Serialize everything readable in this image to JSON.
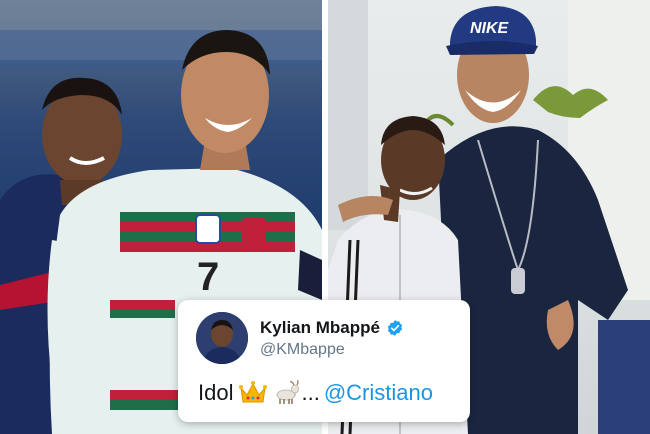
{
  "tweet": {
    "author_name": "Kylian Mbappé",
    "handle": "@KMbappe",
    "text": "Idol",
    "emoji_1": "crown-emoji",
    "emoji_2": "goat-emoji",
    "ellipsis": "...",
    "mention": "@Cristiano"
  },
  "left_photo": {
    "shirt_number": "7"
  },
  "right_photo": {
    "cap_logo": "NIKE"
  },
  "colors": {
    "mention": "#1b95e0",
    "verified": "#1da1f2",
    "handle": "#657786"
  }
}
